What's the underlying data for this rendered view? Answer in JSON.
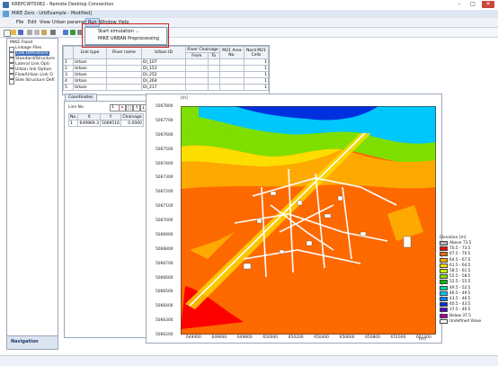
{
  "rdp": {
    "title": "KREPCWT0082 - Remote Desktop Connection",
    "min": "–",
    "max": "□",
    "close": "✕"
  },
  "app": {
    "title": "MIKE Zero - UrbExample - Modified]"
  },
  "menu": {
    "items": [
      "File",
      "Edit",
      "View",
      "Urban parameters",
      "Run",
      "Window",
      "Help"
    ]
  },
  "run_menu": {
    "items": [
      "Start simulation ...",
      "MIKE URBAN Preprocessing"
    ]
  },
  "nav": {
    "root": "MIKE Flood",
    "items": [
      "Linkage Files",
      "Link Definitions",
      "Standard/Structure",
      "Lateral Link Opti",
      "Urban link Option",
      "Flow/Urban Link O",
      "Side Structure Defi"
    ],
    "selected_index": 1,
    "footer": "Navigation"
  },
  "grid": {
    "headers": [
      "",
      "Link type",
      "River name",
      "Urban ID",
      "River Chainage",
      "M21 Area No.",
      "Nord M21 Cells"
    ],
    "chainage_sub": [
      "From",
      "To"
    ],
    "rows": [
      [
        "1",
        "Urban",
        "",
        "DI_107",
        "",
        "",
        "1"
      ],
      [
        "2",
        "Urban",
        "",
        "DI_153",
        "",
        "",
        "1"
      ],
      [
        "3",
        "Urban",
        "",
        "DI_252",
        "",
        "",
        "1"
      ],
      [
        "4",
        "Urban",
        "",
        "DI_264",
        "",
        "",
        "1"
      ],
      [
        "5",
        "Urban",
        "",
        "DI_217",
        "",
        "",
        "1"
      ]
    ]
  },
  "tabs": [
    "Coordinates"
  ],
  "coords": {
    "label": "Line No.",
    "line_value": "1",
    "headers": [
      "No.",
      "X",
      "Y",
      "Chainage"
    ],
    "row": [
      "1",
      "649969.3",
      "5069516",
      "0.0000"
    ]
  },
  "map": {
    "unit_top": "[m]",
    "unit_bottom": "[m]",
    "y_ticks": [
      "5067800",
      "5067700",
      "5067600",
      "5067500",
      "5067400",
      "5067300",
      "5067200",
      "5067100",
      "5067000",
      "5066900",
      "5066800",
      "5066700",
      "5066600",
      "5066500",
      "5066400",
      "5066300",
      "5066200"
    ],
    "x_ticks": [
      "649400",
      "649600",
      "649800",
      "650000",
      "650200",
      "650400",
      "650600",
      "650800",
      "651000",
      "651200"
    ]
  },
  "legend": {
    "title": "Elevation [m]",
    "entries": [
      {
        "label": "Above 73.5",
        "color": "#b8b8b8"
      },
      {
        "label": "70.5 - 73.5",
        "color": "#ff0000"
      },
      {
        "label": "67.5 - 70.5",
        "color": "#ff6a00"
      },
      {
        "label": "64.5 - 67.5",
        "color": "#ffaa00"
      },
      {
        "label": "61.5 - 64.5",
        "color": "#ffdf00"
      },
      {
        "label": "58.5 - 61.5",
        "color": "#c8f000"
      },
      {
        "label": "55.5 - 58.5",
        "color": "#7fe000"
      },
      {
        "label": "52.5 - 55.5",
        "color": "#00c000"
      },
      {
        "label": "49.5 - 52.5",
        "color": "#00d8a0"
      },
      {
        "label": "46.5 - 49.5",
        "color": "#00c8ff"
      },
      {
        "label": "43.5 - 46.5",
        "color": "#0080ff"
      },
      {
        "label": "40.5 - 43.5",
        "color": "#0030e0"
      },
      {
        "label": "37.5 - 40.5",
        "color": "#5000c0"
      },
      {
        "label": "Below 37.5",
        "color": "#a000a0"
      },
      {
        "label": "Undefined Value",
        "color": "#ffffff"
      }
    ]
  }
}
